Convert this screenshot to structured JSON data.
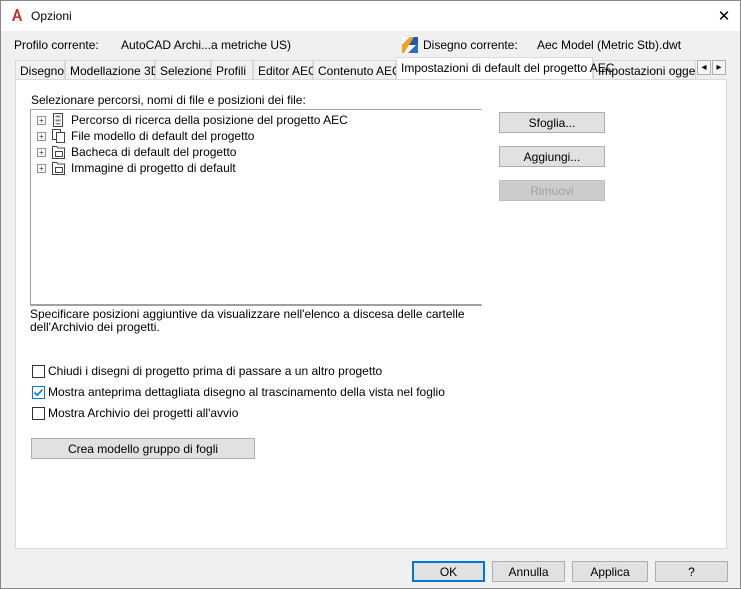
{
  "window": {
    "title": "Opzioni",
    "close_glyph": "✕"
  },
  "profile": {
    "label": "Profilo corrente:",
    "value": "AutoCAD Archi...a metriche US)",
    "drawing_label": "Disegno corrente:",
    "drawing_value": "Aec Model (Metric Stb).dwt"
  },
  "tabs": [
    {
      "label": "Disegno"
    },
    {
      "label": "Modellazione 3D"
    },
    {
      "label": "Selezione"
    },
    {
      "label": "Profili"
    },
    {
      "label": "Editor AEC"
    },
    {
      "label": "Contenuto AEC"
    },
    {
      "label": "Impostazioni di default del progetto AEC",
      "active": true
    },
    {
      "label": "Impostazioni oggetto"
    }
  ],
  "tab_scroll": {
    "left": "◂",
    "right": "▸"
  },
  "panel": {
    "paths_label": "Selezionare percorsi, nomi di file e posizioni dei file:",
    "tree": [
      {
        "label": "Percorso di ricerca della posizione del progetto AEC",
        "icon": "project-folder-icon"
      },
      {
        "label": "File modello di default del progetto",
        "icon": "template-file-icon"
      },
      {
        "label": "Bacheca di default del progetto",
        "icon": "bulletin-board-icon"
      },
      {
        "label": "Immagine di progetto di default",
        "icon": "project-image-icon"
      }
    ],
    "expander_glyph": "+",
    "description": "Specificare posizioni aggiuntive da visualizzare nell'elenco a discesa delle cartelle dell'Archivio dei progetti.",
    "buttons": {
      "browse": "Sfoglia...",
      "add": "Aggiungi...",
      "remove": "Rimuovi"
    },
    "checkboxes": [
      {
        "label": "Chiudi i disegni di progetto prima di passare a un altro progetto",
        "checked": false
      },
      {
        "label": "Mostra anteprima dettagliata disegno al trascinamento della vista nel foglio",
        "checked": true
      },
      {
        "label": "Mostra Archivio dei progetti all'avvio",
        "checked": false
      }
    ],
    "create_template_button": "Crea modello gruppo di fogli"
  },
  "footer": {
    "ok": "OK",
    "cancel": "Annulla",
    "apply": "Applica",
    "help": "?"
  },
  "colors": {
    "accent": "#0078d7",
    "app_icon_red": "#d42b2b"
  }
}
